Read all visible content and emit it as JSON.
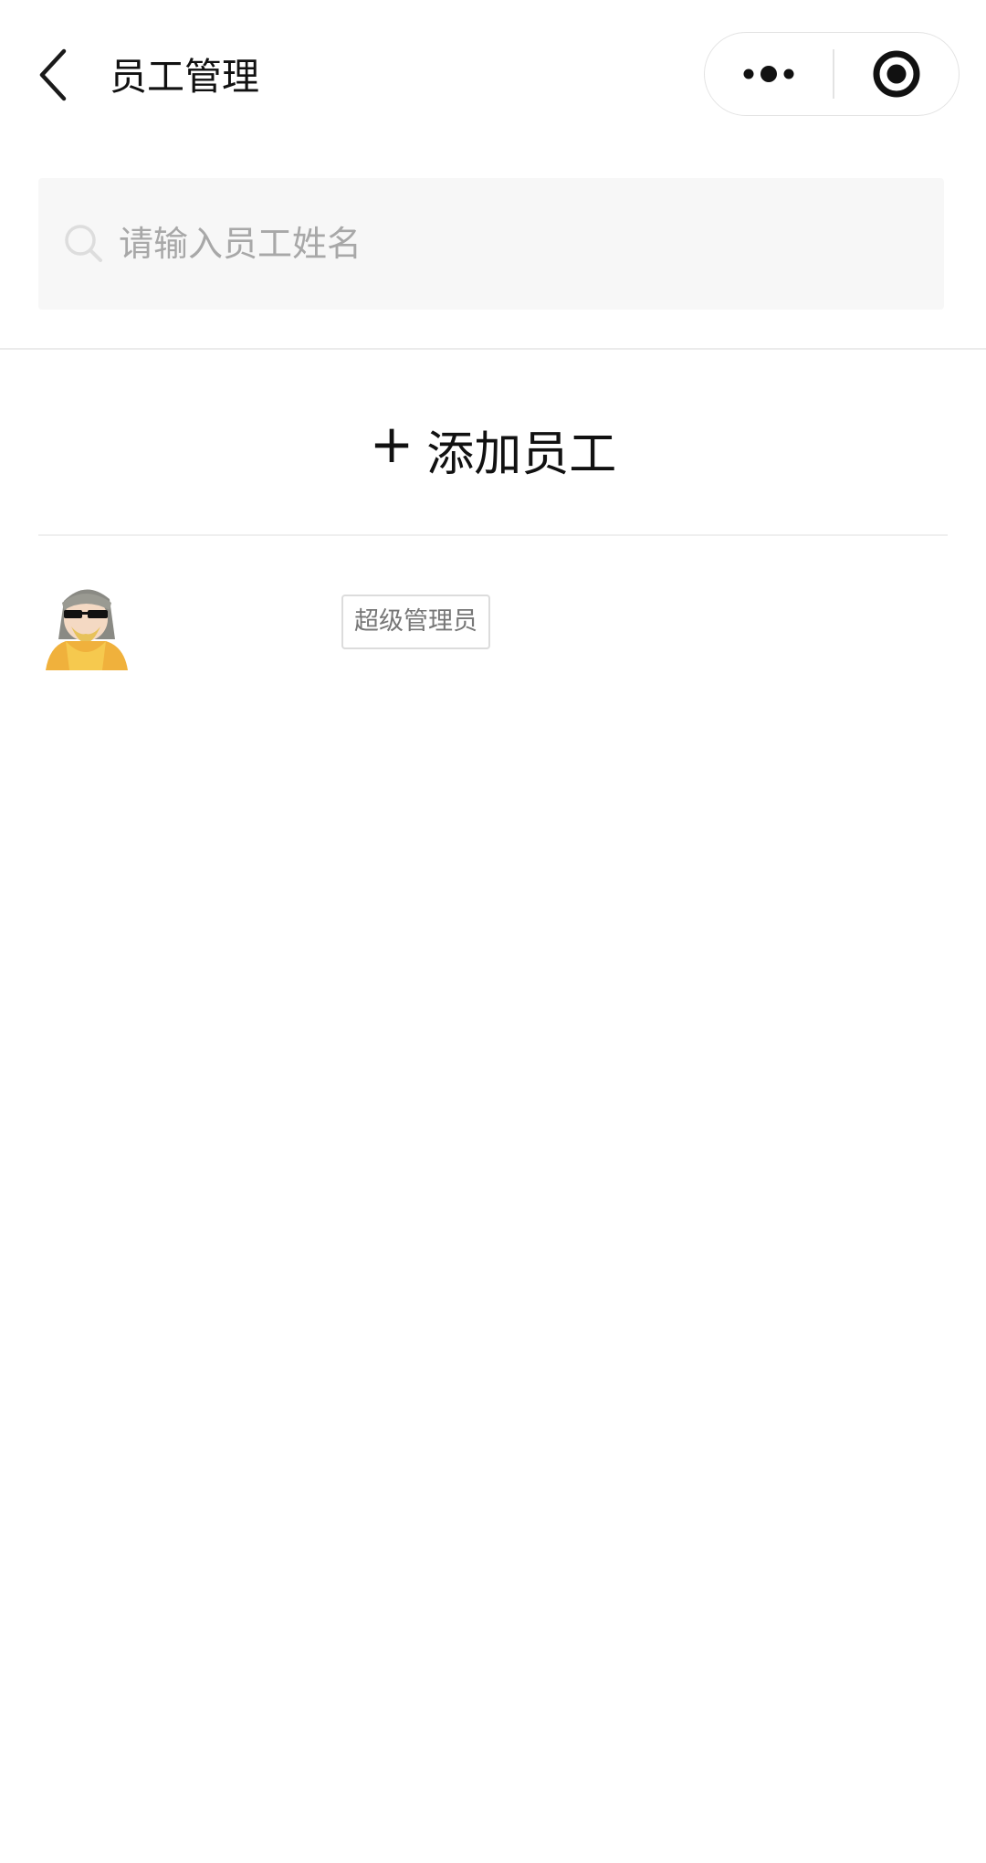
{
  "nav": {
    "title": "员工管理",
    "back_icon": "chevron-left-icon",
    "more_icon": "more-dots-icon",
    "close_icon": "target-circle-icon"
  },
  "search": {
    "placeholder": "请输入员工姓名",
    "value": "",
    "icon": "search-icon"
  },
  "add_employee": {
    "plus": "+",
    "label": "添加员工"
  },
  "employees": [
    {
      "avatar_icon": "cartoon-avatar",
      "role": "超级管理员"
    }
  ],
  "colors": {
    "background": "#ffffff",
    "search_bg": "#f7f7f7",
    "placeholder": "#a8a8a8",
    "badge_border": "#dcdcdc",
    "badge_text": "#777777"
  }
}
